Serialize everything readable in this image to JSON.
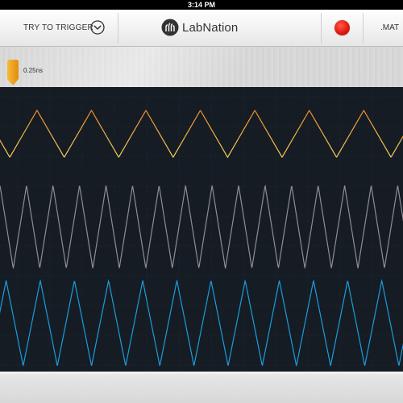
{
  "status_bar": {
    "time": "3:14 PM"
  },
  "toolbar": {
    "trigger_label": "TRY TO TRIGGER",
    "dropdown_icon": "chevron-down-circle-icon",
    "logo_text": "LabNation",
    "logo_icon": "labnation-logo-icon",
    "record_icon": "record-dot-icon",
    "export_label": ".MAT"
  },
  "cursor": {
    "value_label": "0.25ns",
    "handle_icon": "cursor-marker-icon"
  },
  "colors": {
    "channel1": "#f5a623",
    "channel2": "#8e8e93",
    "channel3": "#1a9ddb",
    "scope_bg": "#161c24",
    "grid": "#2a323d",
    "record": "#e11a10"
  },
  "waveforms": [
    {
      "name": "channel-1",
      "shape": "triangle",
      "cycles": 7.4,
      "phase": 0.82,
      "level_top": 0.22,
      "level_bottom": 0.78
    },
    {
      "name": "channel-2",
      "shape": "triangle",
      "cycles": 15.2,
      "phase": 0.5,
      "level_top": 0.0,
      "level_bottom": 1.0
    },
    {
      "name": "channel-3",
      "shape": "triangle",
      "cycles": 11.8,
      "phase": 0.32,
      "level_top": 0.0,
      "level_bottom": 1.0
    }
  ]
}
